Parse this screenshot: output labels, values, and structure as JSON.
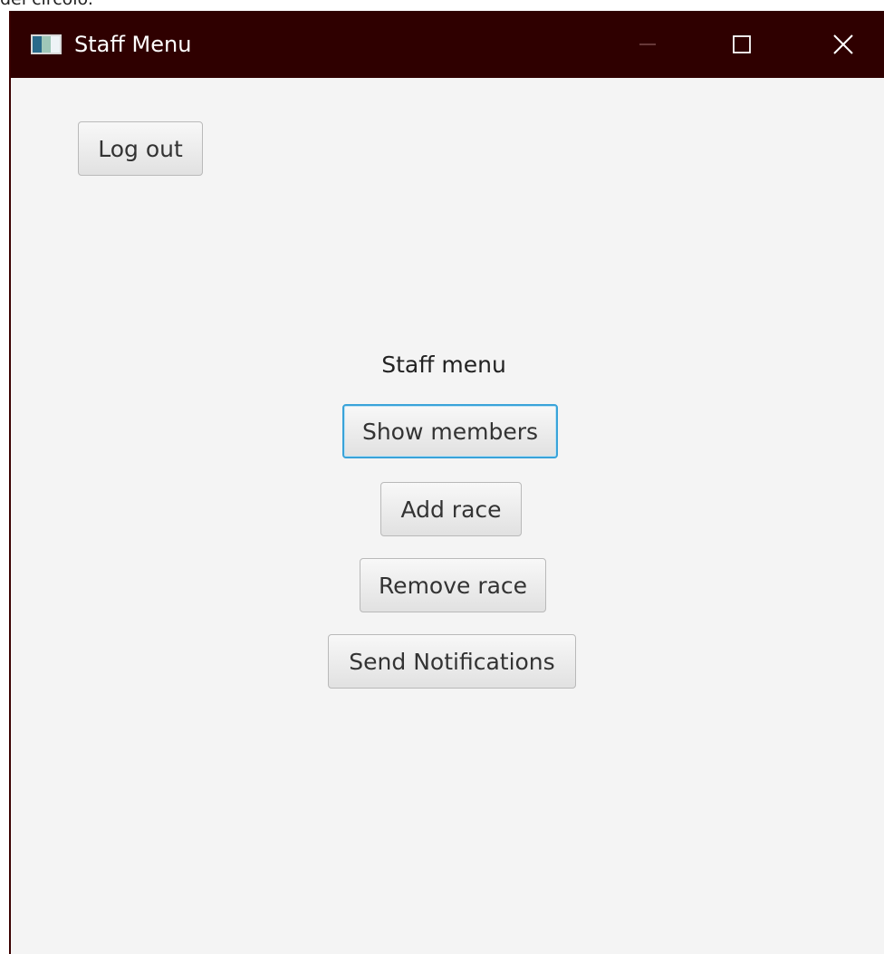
{
  "page": {
    "caption": "del circolo."
  },
  "window": {
    "title": "Staff Menu",
    "icon": "app-window-icon",
    "controls": {
      "minimize_icon": "minimize-icon",
      "maximize_icon": "maximize-icon",
      "close_icon": "close-icon"
    },
    "titlebar_color": "#2f0000"
  },
  "toolbar": {
    "logout_label": "Log out"
  },
  "menu": {
    "title": "Staff menu",
    "buttons": {
      "show_members": "Show members",
      "add_race": "Add race",
      "remove_race": "Remove race",
      "send_notifications": "Send Notifications"
    },
    "focused_button": "Show members",
    "focus_color": "#39a3d9"
  }
}
